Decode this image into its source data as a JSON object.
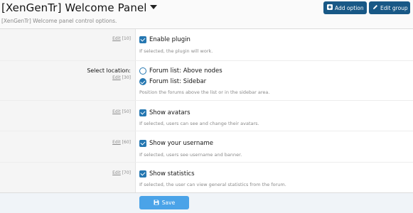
{
  "header": {
    "title": "[XenGenTr] Welcome Panel",
    "description": "[XenGenTr] Welcome panel control options.",
    "add_option_label": "Add option",
    "edit_group_label": "Edit group"
  },
  "options": [
    {
      "edit": "Edit",
      "order": "[10]",
      "control": "Enable plugin",
      "hint": "If selected, the plugin will work."
    },
    {
      "label": "Select location:",
      "edit": "Edit",
      "order": "[30]",
      "choices": [
        "Forum list: Above nodes",
        "Forum list: Sidebar"
      ],
      "selected": "Forum list: Sidebar",
      "hint": "Position the forums above the list or in the sidebar area."
    },
    {
      "edit": "Edit",
      "order": "[50]",
      "control": "Show avatars",
      "hint": "If selected, users can see and change their avatars."
    },
    {
      "edit": "Edit",
      "order": "[60]",
      "control": "Show your username",
      "hint": "If selected, users see username and banner."
    },
    {
      "edit": "Edit",
      "order": "[70]",
      "control": "Show statistics",
      "hint": "If selected, the user can view general statistics from the forum."
    }
  ],
  "footer": {
    "save_label": "Save"
  },
  "colors": {
    "primary": "#185886",
    "checkbox": "#2577b1",
    "save": "#4aa3e8"
  }
}
